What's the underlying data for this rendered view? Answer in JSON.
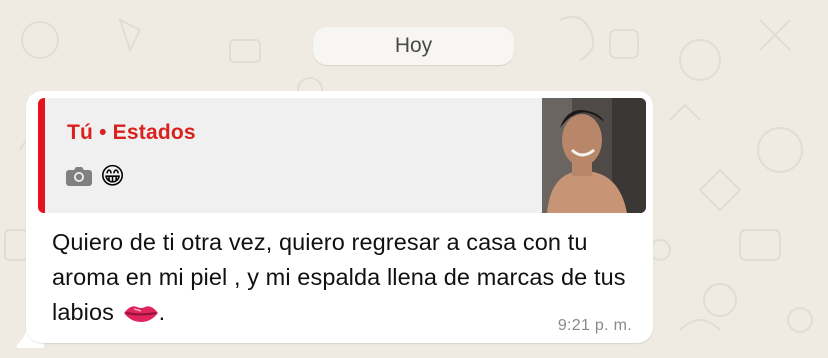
{
  "date_divider": {
    "label": "Hoy"
  },
  "message": {
    "quote": {
      "title": "Tú • Estados",
      "icons": [
        "camera-icon"
      ],
      "emoji": "😁",
      "thumbnail": "status-photo"
    },
    "text": "Quiero de ti otra vez, quiero regresar a casa con tu aroma en mi piel , y mi espalda llena de marcas de tus labios",
    "text_end": ".",
    "emoji_inline": "lips-icon",
    "time": "9:21 p. m."
  },
  "colors": {
    "background": "#efeae2",
    "bubble": "#ffffff",
    "quote_bg": "#f0f0f0",
    "quote_accent": "#e3141c",
    "quote_title": "#d9211d",
    "time": "#8a8a8a"
  }
}
